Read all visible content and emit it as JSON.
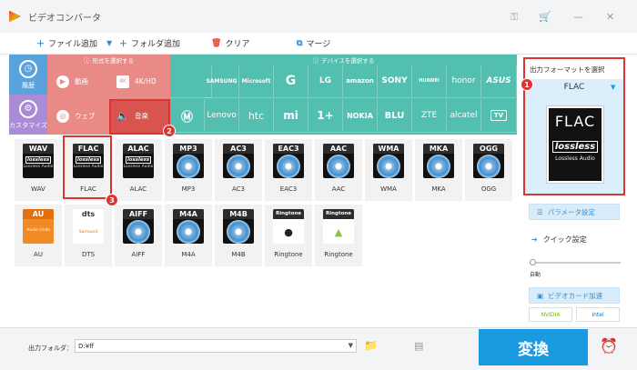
{
  "app": {
    "title": "ビデオコンバータ"
  },
  "toolbar": {
    "add_file": "ファイル追加",
    "add_folder": "フォルダ追加",
    "clear": "クリア",
    "merge": "マージ"
  },
  "sidebar": {
    "history": "履歴",
    "custom": "カスタマイズ"
  },
  "format_section": {
    "header": "形式を選択する",
    "buttons": [
      {
        "label": "動画",
        "icon": "play-icon"
      },
      {
        "label": "4K/HD",
        "icon": "4k-icon"
      },
      {
        "label": "ウェブ",
        "icon": "chrome-icon"
      },
      {
        "label": "音楽",
        "icon": "speaker-icon"
      }
    ]
  },
  "device_section": {
    "header": "デバイスを選択する",
    "row1": [
      "",
      "SAMSUNG",
      "Microsoft",
      "G",
      "LG",
      "amazon",
      "SONY",
      "HUAWEI",
      "honor",
      "ASUS"
    ],
    "row2": [
      "motorola",
      "Lenovo",
      "htc",
      "mi",
      "1+",
      "NOKIA",
      "BLU",
      "ZTE",
      "alcatel",
      "TV"
    ]
  },
  "formats": [
    {
      "name": "WAV",
      "label": "WAV",
      "style": "lossless"
    },
    {
      "name": "FLAC",
      "label": "FLAC",
      "style": "lossless"
    },
    {
      "name": "ALAC",
      "label": "ALAC",
      "style": "lossless"
    },
    {
      "name": "MP3",
      "label": "MP3",
      "style": "disc"
    },
    {
      "name": "AC3",
      "label": "AC3",
      "style": "disc"
    },
    {
      "name": "EAC3",
      "label": "EAC3",
      "style": "disc"
    },
    {
      "name": "AAC",
      "label": "AAC",
      "style": "disc"
    },
    {
      "name": "WMA",
      "label": "WMA",
      "style": "disc"
    },
    {
      "name": "MKA",
      "label": "MKA",
      "style": "disc"
    },
    {
      "name": "OGG",
      "label": "OGG",
      "style": "disc"
    },
    {
      "name": "AU",
      "label": "AU",
      "style": "au"
    },
    {
      "name": "dts",
      "label": "DTS",
      "style": "dts"
    },
    {
      "name": "AIFF",
      "label": "AIFF",
      "style": "disc"
    },
    {
      "name": "M4A",
      "label": "M4A",
      "style": "disc"
    },
    {
      "name": "M4B",
      "label": "M4B",
      "style": "disc"
    },
    {
      "name": "Ringtone",
      "label": "Ringtone",
      "style": "apple"
    },
    {
      "name": "Ringtone",
      "label": "Ringtone",
      "style": "android"
    }
  ],
  "lossless_text": "lossless",
  "lossless_audio": "Lossless Audio",
  "au_sub": "Audio Units",
  "dts_sub": "Surround",
  "output": {
    "header": "出力フォーマットを選択",
    "selected": "FLAC",
    "big_badge": "FLAC",
    "big_lossless": "lossless",
    "big_sub": "Lossless Audio"
  },
  "right": {
    "params": "パラメータ設定",
    "quick": "クイック設定",
    "auto": "自動",
    "gpu": "ビデオカード加速",
    "nvidia": "NVIDIA",
    "intel": "Intel"
  },
  "bottom": {
    "folder_label": "出力フォルダ：",
    "folder_value": "D:¥ff",
    "convert": "変換"
  },
  "markers": [
    "1",
    "2",
    "3"
  ],
  "colors": {
    "accent": "#1a9ae0",
    "format": "#e98a86",
    "device": "#52bfb1",
    "sidebar": "#59a3dd",
    "marker": "#dd3333"
  }
}
